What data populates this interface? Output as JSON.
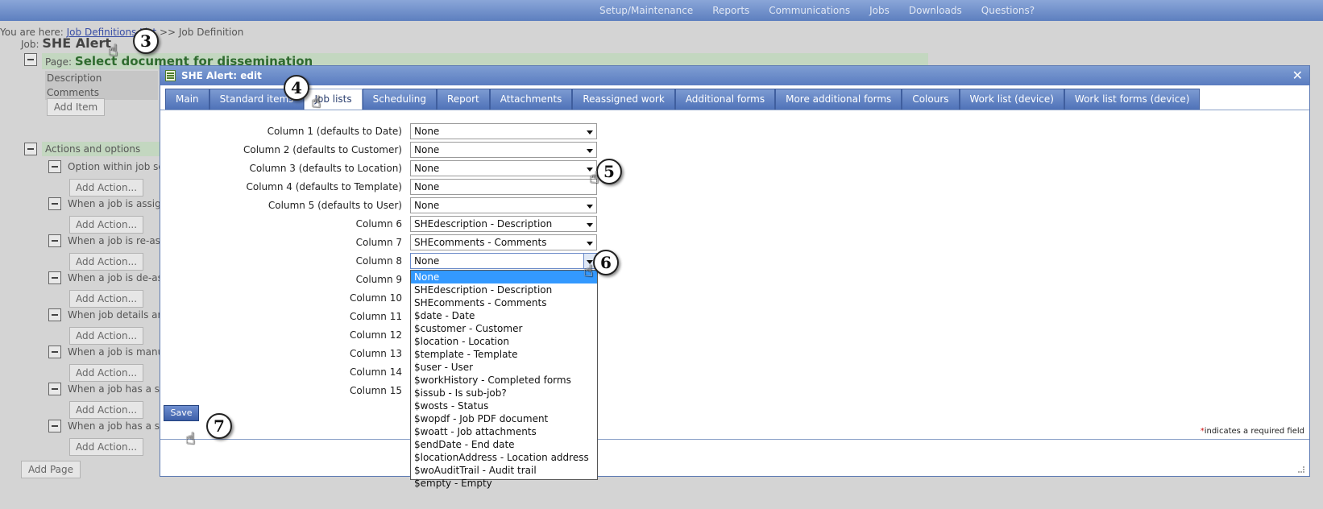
{
  "topnav": [
    "Setup/Maintenance",
    "Reports",
    "Communications",
    "Jobs",
    "Downloads",
    "Questions?"
  ],
  "breadcrumb": {
    "prefix": "You are here:",
    "link": "Job Definitions List",
    "sep": ">>",
    "current": "Job Definition"
  },
  "job": {
    "label": "Job:",
    "name": "SHE Alert"
  },
  "page_section": {
    "label": "Page:",
    "name": "Select document for dissemination"
  },
  "page_items": [
    "Description",
    "Comments"
  ],
  "add_item_label": "Add Item",
  "actions_title": "Actions and options",
  "actions": [
    "Option within job sc",
    "When a job is assig",
    "When a job is re-as",
    "When a job is de-as",
    "When job details ar",
    "When a job is manu",
    "When a job has a s",
    "When a job has a s"
  ],
  "add_action_label": "Add Action...",
  "add_page_label": "Add Page",
  "modal": {
    "title": "SHE Alert: edit",
    "close": "✕",
    "tabs": [
      "Main",
      "Standard items",
      "Job lists",
      "Scheduling",
      "Report",
      "Attachments",
      "Reassigned work",
      "Additional forms",
      "More additional forms",
      "Colours",
      "Work list (device)",
      "Work list forms (device)"
    ],
    "active_tab": "Job lists",
    "rows": [
      {
        "label": "Column 1 (defaults to Date)",
        "value": "None"
      },
      {
        "label": "Column 2 (defaults to Customer)",
        "value": "None"
      },
      {
        "label": "Column 3 (defaults to Location)",
        "value": "None"
      },
      {
        "label": "Column 4 (defaults to Template)",
        "value": "None"
      },
      {
        "label": "Column 5 (defaults to User)",
        "value": "None"
      },
      {
        "label": "Column 6",
        "value": "SHEdescription - Description"
      },
      {
        "label": "Column 7",
        "value": "SHEcomments - Comments"
      },
      {
        "label": "Column 8",
        "value": "None"
      },
      {
        "label": "Column 9",
        "value": ""
      },
      {
        "label": "Column 10",
        "value": ""
      },
      {
        "label": "Column 11",
        "value": ""
      },
      {
        "label": "Column 12",
        "value": ""
      },
      {
        "label": "Column 13",
        "value": ""
      },
      {
        "label": "Column 14",
        "value": ""
      },
      {
        "label": "Column 15",
        "value": ""
      }
    ],
    "dropdown_options": [
      "None",
      "SHEdescription - Description",
      "SHEcomments - Comments",
      "$date - Date",
      "$customer - Customer",
      "$location - Location",
      "$template - Template",
      "$user - User",
      "$workHistory - Completed forms",
      "$issub - Is sub-job?",
      "$wosts - Status",
      "$wopdf - Job PDF document",
      "$woatt - Job attachments",
      "$endDate - End date",
      "$locationAddress - Location address",
      "$woAuditTrail - Audit trail",
      "$empty - Empty"
    ],
    "save_label": "Save",
    "required_mark": "*",
    "required_note": "indicates a required field"
  },
  "steps": [
    "3",
    "4",
    "5",
    "6",
    "7"
  ]
}
